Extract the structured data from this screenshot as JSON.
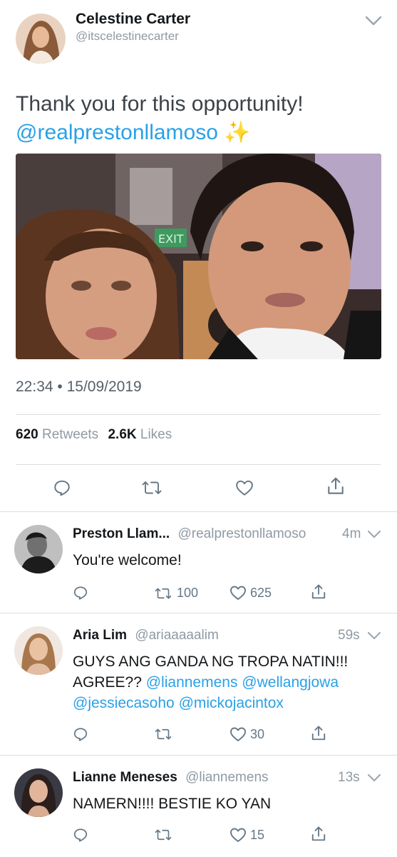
{
  "main_tweet": {
    "author_name": "Celestine Carter",
    "author_handle": "@itscelestinecarter",
    "text": "Thank you for this opportunity!",
    "mention": "@realprestonllamoso",
    "emoji": "✨",
    "photo_sign": "EXIT",
    "time": "22:34",
    "date": "15/09/2019",
    "retweets_count": "620",
    "retweets_label": "Retweets",
    "likes_count": "2.6K",
    "likes_label": "Likes"
  },
  "replies": [
    {
      "name": "Preston Llam...",
      "handle": "@realprestonllamoso",
      "time": "4m",
      "text": "You're welcome!",
      "retweets": "100",
      "likes": "625"
    },
    {
      "name": "Aria Lim",
      "handle": "@ariaaaaalim",
      "time": "59s",
      "text_line1": "GUYS ANG GANDA NG TROPA NATIN!!!",
      "text_line2_prefix": "AGREE??",
      "mention1": "@liannemens",
      "mention2": "@wellangjowa",
      "mention3": "@jessiecasoho",
      "mention4": "@mickojacintox",
      "retweets": "",
      "likes": "30"
    },
    {
      "name": "Lianne Meneses",
      "handle": "@liannemens",
      "time": "13s",
      "text": "NAMERN!!!! BESTIE KO YAN",
      "retweets": "",
      "likes": "15"
    }
  ],
  "icons": {
    "reply": "reply-icon",
    "retweet": "retweet-icon",
    "like": "heart-icon",
    "share": "share-icon",
    "caret": "chevron-down-icon"
  },
  "colors": {
    "link": "#2aa1e6",
    "secondary_text": "#8f9aa3",
    "icon": "#657786"
  }
}
